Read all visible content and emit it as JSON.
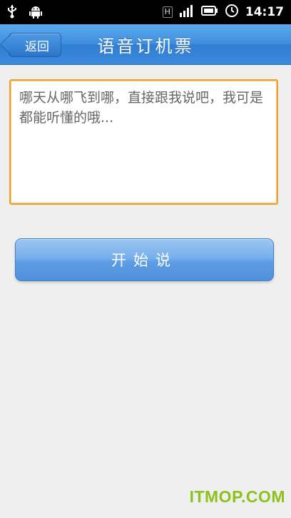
{
  "status_bar": {
    "network_indicator": "H",
    "time": "14:17",
    "icons": [
      "usb-icon",
      "android-debug-icon",
      "signal-icon",
      "battery-icon",
      "alarm-clock-icon"
    ]
  },
  "title_bar": {
    "back_label": "返回",
    "title": "语音订机票",
    "color": "#3f8fdf"
  },
  "voice_input": {
    "value": "",
    "placeholder": "哪天从哪飞到哪，直接跟我说吧，我可是都能听懂的哦...",
    "border_color": "#f0a030"
  },
  "start_button": {
    "label": "开始说"
  },
  "watermark": {
    "text": "ITMOP.COM"
  }
}
